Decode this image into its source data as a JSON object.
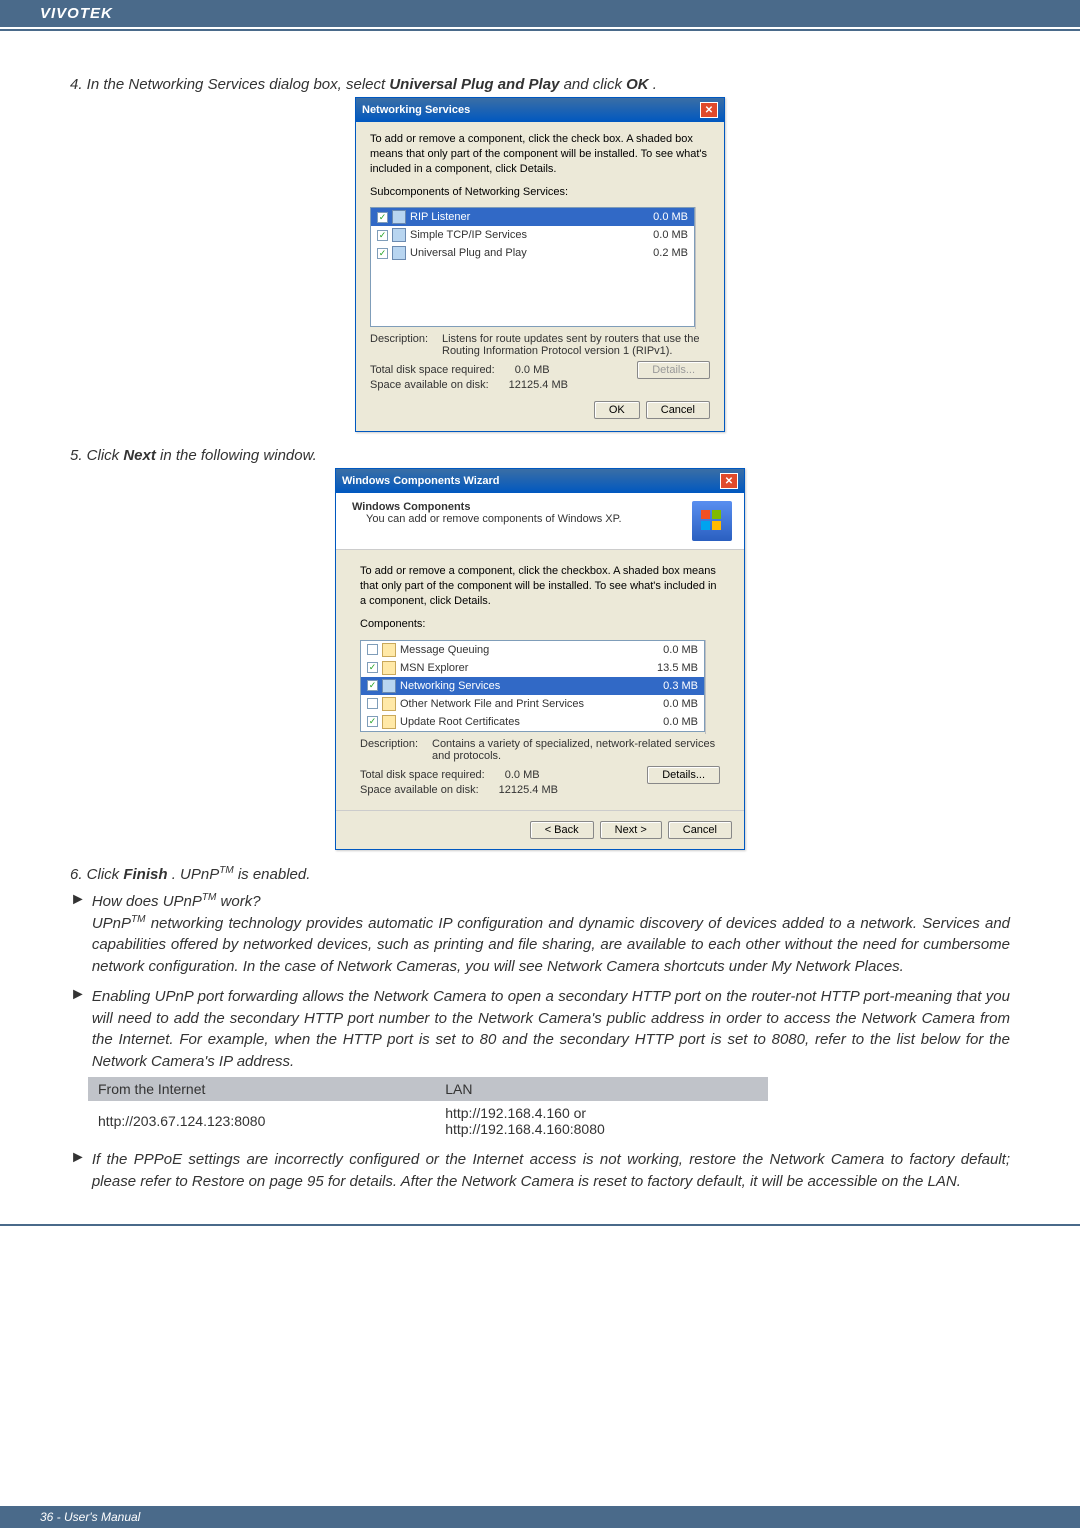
{
  "header_brand": "VIVOTEK",
  "step4": "4. In the Networking Services dialog box, select ",
  "step4_b1": "Universal Plug and Play",
  "step4_mid": " and click ",
  "step4_b2": "OK",
  "step4_end": ".",
  "ns": {
    "title": "Networking Services",
    "intro": "To add or remove a component, click the check box. A shaded box means that only part of the component will be installed. To see what's included in a component, click Details.",
    "sub_label": "Subcomponents of Networking Services:",
    "rows": [
      {
        "name": "RIP Listener",
        "size": "0.0 MB"
      },
      {
        "name": "Simple TCP/IP Services",
        "size": "0.0 MB"
      },
      {
        "name": "Universal Plug and Play",
        "size": "0.2 MB"
      }
    ],
    "desc_lbl": "Description:",
    "desc_txt": "Listens for route updates sent by routers that use the Routing Information Protocol version 1 (RIPv1).",
    "tot_lbl": "Total disk space required:",
    "tot_val": "0.0 MB",
    "avail_lbl": "Space available on disk:",
    "avail_val": "12125.4 MB",
    "btn_details": "Details...",
    "btn_ok": "OK",
    "btn_cancel": "Cancel"
  },
  "step5": "5. Click ",
  "step5_b": "Next",
  "step5_end": " in the following window.",
  "wiz": {
    "title": "Windows Components Wizard",
    "hdr": "Windows Components",
    "sub": "You can add or remove components of Windows XP.",
    "intro": "To add or remove a component, click the checkbox. A shaded box means that only part of the component will be installed. To see what's included in a component, click Details.",
    "label": "Components:",
    "rows": [
      {
        "name": "Message Queuing",
        "size": "0.0 MB",
        "chk": false
      },
      {
        "name": "MSN Explorer",
        "size": "13.5 MB",
        "chk": true
      },
      {
        "name": "Networking Services",
        "size": "0.3 MB",
        "chk": true,
        "sel": true
      },
      {
        "name": "Other Network File and Print Services",
        "size": "0.0 MB",
        "chk": false
      },
      {
        "name": "Update Root Certificates",
        "size": "0.0 MB",
        "chk": true
      }
    ],
    "desc_lbl": "Description:",
    "desc_txt": "Contains a variety of specialized, network-related services and protocols.",
    "tot_lbl": "Total disk space required:",
    "tot_val": "0.0 MB",
    "avail_lbl": "Space available on disk:",
    "avail_val": "12125.4 MB",
    "btn_details": "Details...",
    "btn_back": "< Back",
    "btn_next": "Next >",
    "btn_cancel": "Cancel"
  },
  "step6_pre": "6. Click ",
  "step6_b": "Finish",
  "step6_post": ". UPnP",
  "step6_tm": "TM",
  "step6_end": " is enabled.",
  "q1_pre": "How does UPnP",
  "q1_tm": "TM",
  "q1_post": " work?",
  "a1_pre": "UPnP",
  "a1_tm": "TM",
  "a1_txt": " networking technology provides automatic IP configuration and dynamic discovery of devices added to a network. Services and capabilities offered by networked devices, such as printing and file sharing, are available to each other without the need for cumbersome network configuration. In the case of Network Cameras, you will see Network Camera shortcuts under My Network Places.",
  "p_forward": "Enabling UPnP port forwarding allows the Network Camera to open a secondary HTTP port on the router-not HTTP port-meaning that you will need to add the secondary HTTP port number to the Network Camera's public address in order to access the Network Camera from the Internet. For example, when the HTTP port is set to 80 and the secondary HTTP port is set to 8080, refer to the list below for the Network Camera's IP address.",
  "tbl": {
    "h1": "From the Internet",
    "h2": "LAN",
    "c1": "http://203.67.124.123:8080",
    "c2a": "http://192.168.4.160 or",
    "c2b": "http://192.168.4.160:8080"
  },
  "p_pppoe": "If the PPPoE settings are incorrectly configured or the Internet access is not working, restore the Network Camera to factory default; please refer to Restore on page 95 for details. After the Network Camera is reset to factory default, it will be accessible on the LAN.",
  "footer": "36 - User's Manual"
}
